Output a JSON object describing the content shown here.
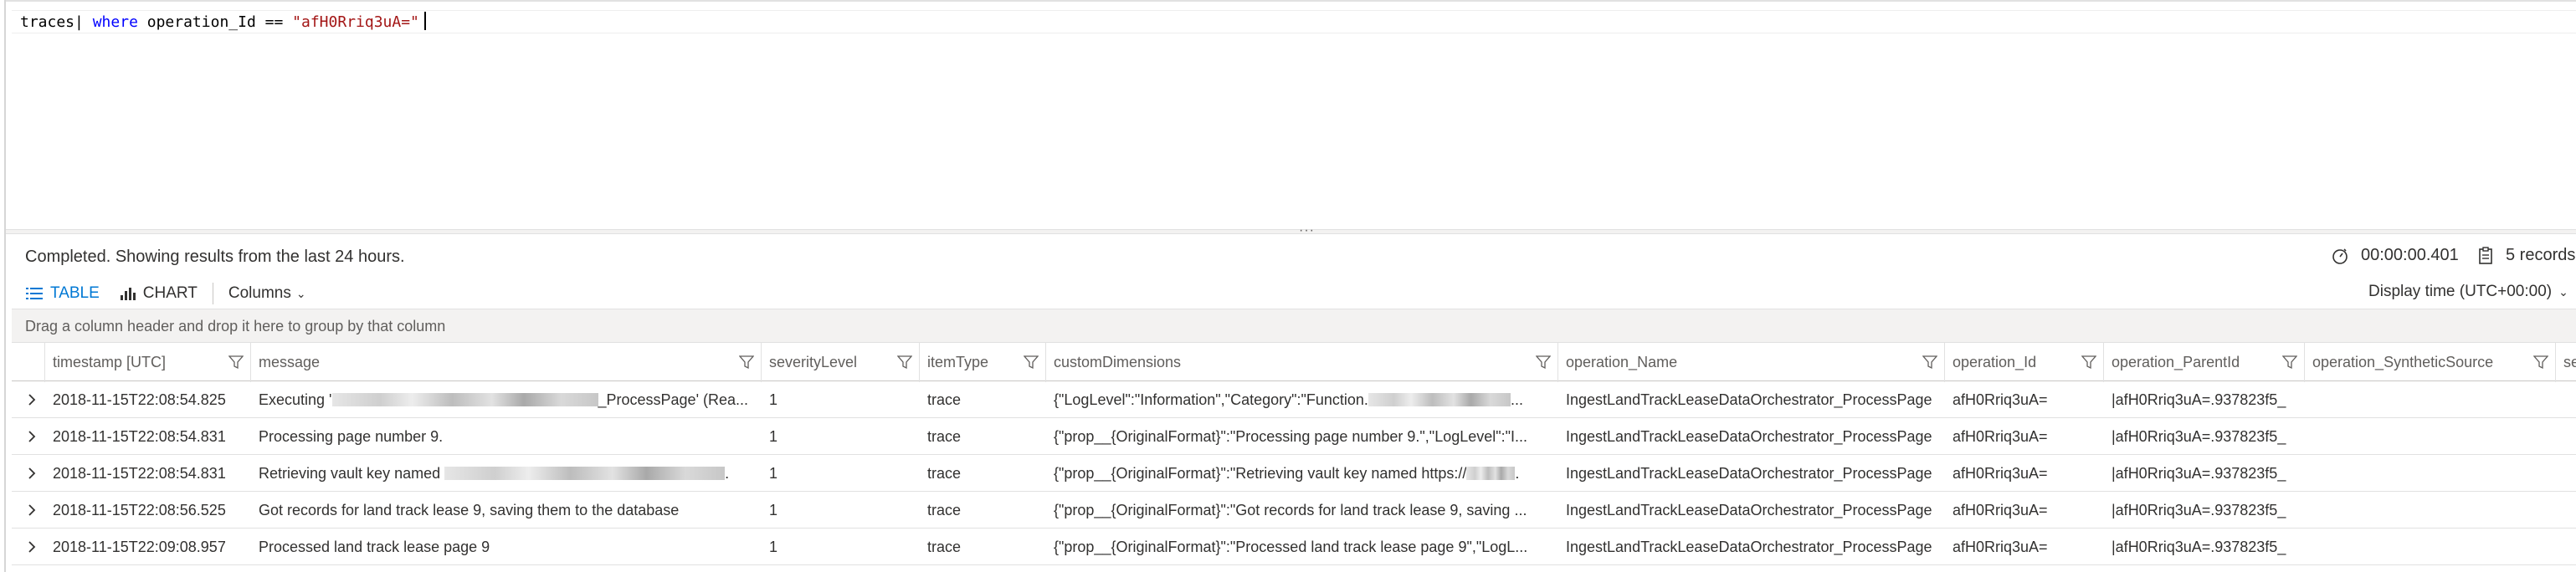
{
  "editor": {
    "query": {
      "table": "traces",
      "pipe": "|",
      "keyword": "where",
      "column": "operation_Id",
      "operator": "==",
      "value": "\"afH0Rriq3uA=\""
    }
  },
  "splitter": {
    "grip": "···"
  },
  "results": {
    "status": "Completed. Showing results from the last 24 hours.",
    "duration": "00:00:00.401",
    "records": "5 records"
  },
  "toolbar": {
    "table_label": "TABLE",
    "chart_label": "CHART",
    "columns_label": "Columns",
    "display_time": "Display time (UTC+00:00)"
  },
  "groupbar": {
    "hint": "Drag a column header and drop it here to group by that column"
  },
  "grid": {
    "columns": [
      "timestamp [UTC]",
      "message",
      "severityLevel",
      "itemType",
      "customDimensions",
      "operation_Name",
      "operation_Id",
      "operation_ParentId",
      "operation_SyntheticSource",
      "session_I"
    ],
    "rows": [
      {
        "timestamp": "2018-11-15T22:08:54.825",
        "message_pre": "Executing '",
        "message_post": "_ProcessPage' (Rea...",
        "severityLevel": "1",
        "itemType": "trace",
        "customDimensions": "{\"LogLevel\":\"Information\",\"Category\":\"Function.",
        "customDimensions_post": "...",
        "operation_Name": "IngestLandTrackLeaseDataOrchestrator_ProcessPage",
        "operation_Id": "afH0Rriq3uA=",
        "operation_ParentId": "|afH0Rriq3uA=.937823f5_"
      },
      {
        "timestamp": "2018-11-15T22:08:54.831",
        "message_pre": "Processing page number 9.",
        "message_post": "",
        "severityLevel": "1",
        "itemType": "trace",
        "customDimensions": "{\"prop__{OriginalFormat}\":\"Processing page number 9.\",\"LogLevel\":\"I...",
        "customDimensions_post": "",
        "operation_Name": "IngestLandTrackLeaseDataOrchestrator_ProcessPage",
        "operation_Id": "afH0Rriq3uA=",
        "operation_ParentId": "|afH0Rriq3uA=.937823f5_"
      },
      {
        "timestamp": "2018-11-15T22:08:54.831",
        "message_pre": "Retrieving vault key named ",
        "message_post": ".",
        "severityLevel": "1",
        "itemType": "trace",
        "customDimensions": "{\"prop__{OriginalFormat}\":\"Retrieving vault key named https://",
        "customDimensions_post": ".",
        "operation_Name": "IngestLandTrackLeaseDataOrchestrator_ProcessPage",
        "operation_Id": "afH0Rriq3uA=",
        "operation_ParentId": "|afH0Rriq3uA=.937823f5_"
      },
      {
        "timestamp": "2018-11-15T22:08:56.525",
        "message_pre": "Got records for land track lease 9, saving them to the database",
        "message_post": "",
        "severityLevel": "1",
        "itemType": "trace",
        "customDimensions": "{\"prop__{OriginalFormat}\":\"Got records for land track lease 9, saving ...",
        "customDimensions_post": "",
        "operation_Name": "IngestLandTrackLeaseDataOrchestrator_ProcessPage",
        "operation_Id": "afH0Rriq3uA=",
        "operation_ParentId": "|afH0Rriq3uA=.937823f5_"
      },
      {
        "timestamp": "2018-11-15T22:09:08.957",
        "message_pre": "Processed land track lease page 9",
        "message_post": "",
        "severityLevel": "1",
        "itemType": "trace",
        "customDimensions": "{\"prop__{OriginalFormat}\":\"Processed land track lease page 9\",\"LogL...",
        "customDimensions_post": "",
        "operation_Name": "IngestLandTrackLeaseDataOrchestrator_ProcessPage",
        "operation_Id": "afH0Rriq3uA=",
        "operation_ParentId": "|afH0Rriq3uA=.937823f5_"
      }
    ]
  },
  "icons": {
    "timer": "stopwatch-icon",
    "records": "clipboard-icon",
    "table": "table-list-icon",
    "chart": "bar-chart-icon",
    "filter": "filter-funnel-icon",
    "expand": "chevron-right-icon"
  },
  "colors": {
    "accent": "#0078d4",
    "keyword": "#0000ff",
    "string": "#a31515"
  }
}
